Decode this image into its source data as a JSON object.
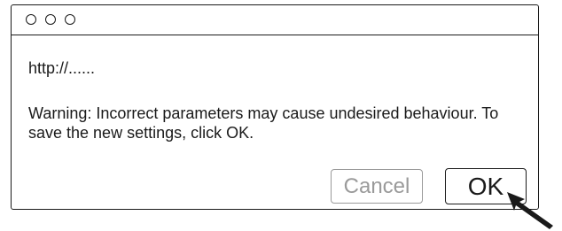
{
  "window": {
    "controls": [
      "close",
      "minimize",
      "zoom"
    ]
  },
  "dialog": {
    "url": "http://......",
    "message": "Warning: Incorrect parameters may cause undesired behaviour. To save the new settings, click OK."
  },
  "buttons": {
    "cancel_label": "Cancel",
    "ok_label": "OK"
  },
  "colors": {
    "border": "#1a1a1a",
    "disabled_text": "#9a9a9a",
    "background": "#ffffff"
  },
  "icons": {
    "pointer": "arrow-cursor-icon"
  }
}
